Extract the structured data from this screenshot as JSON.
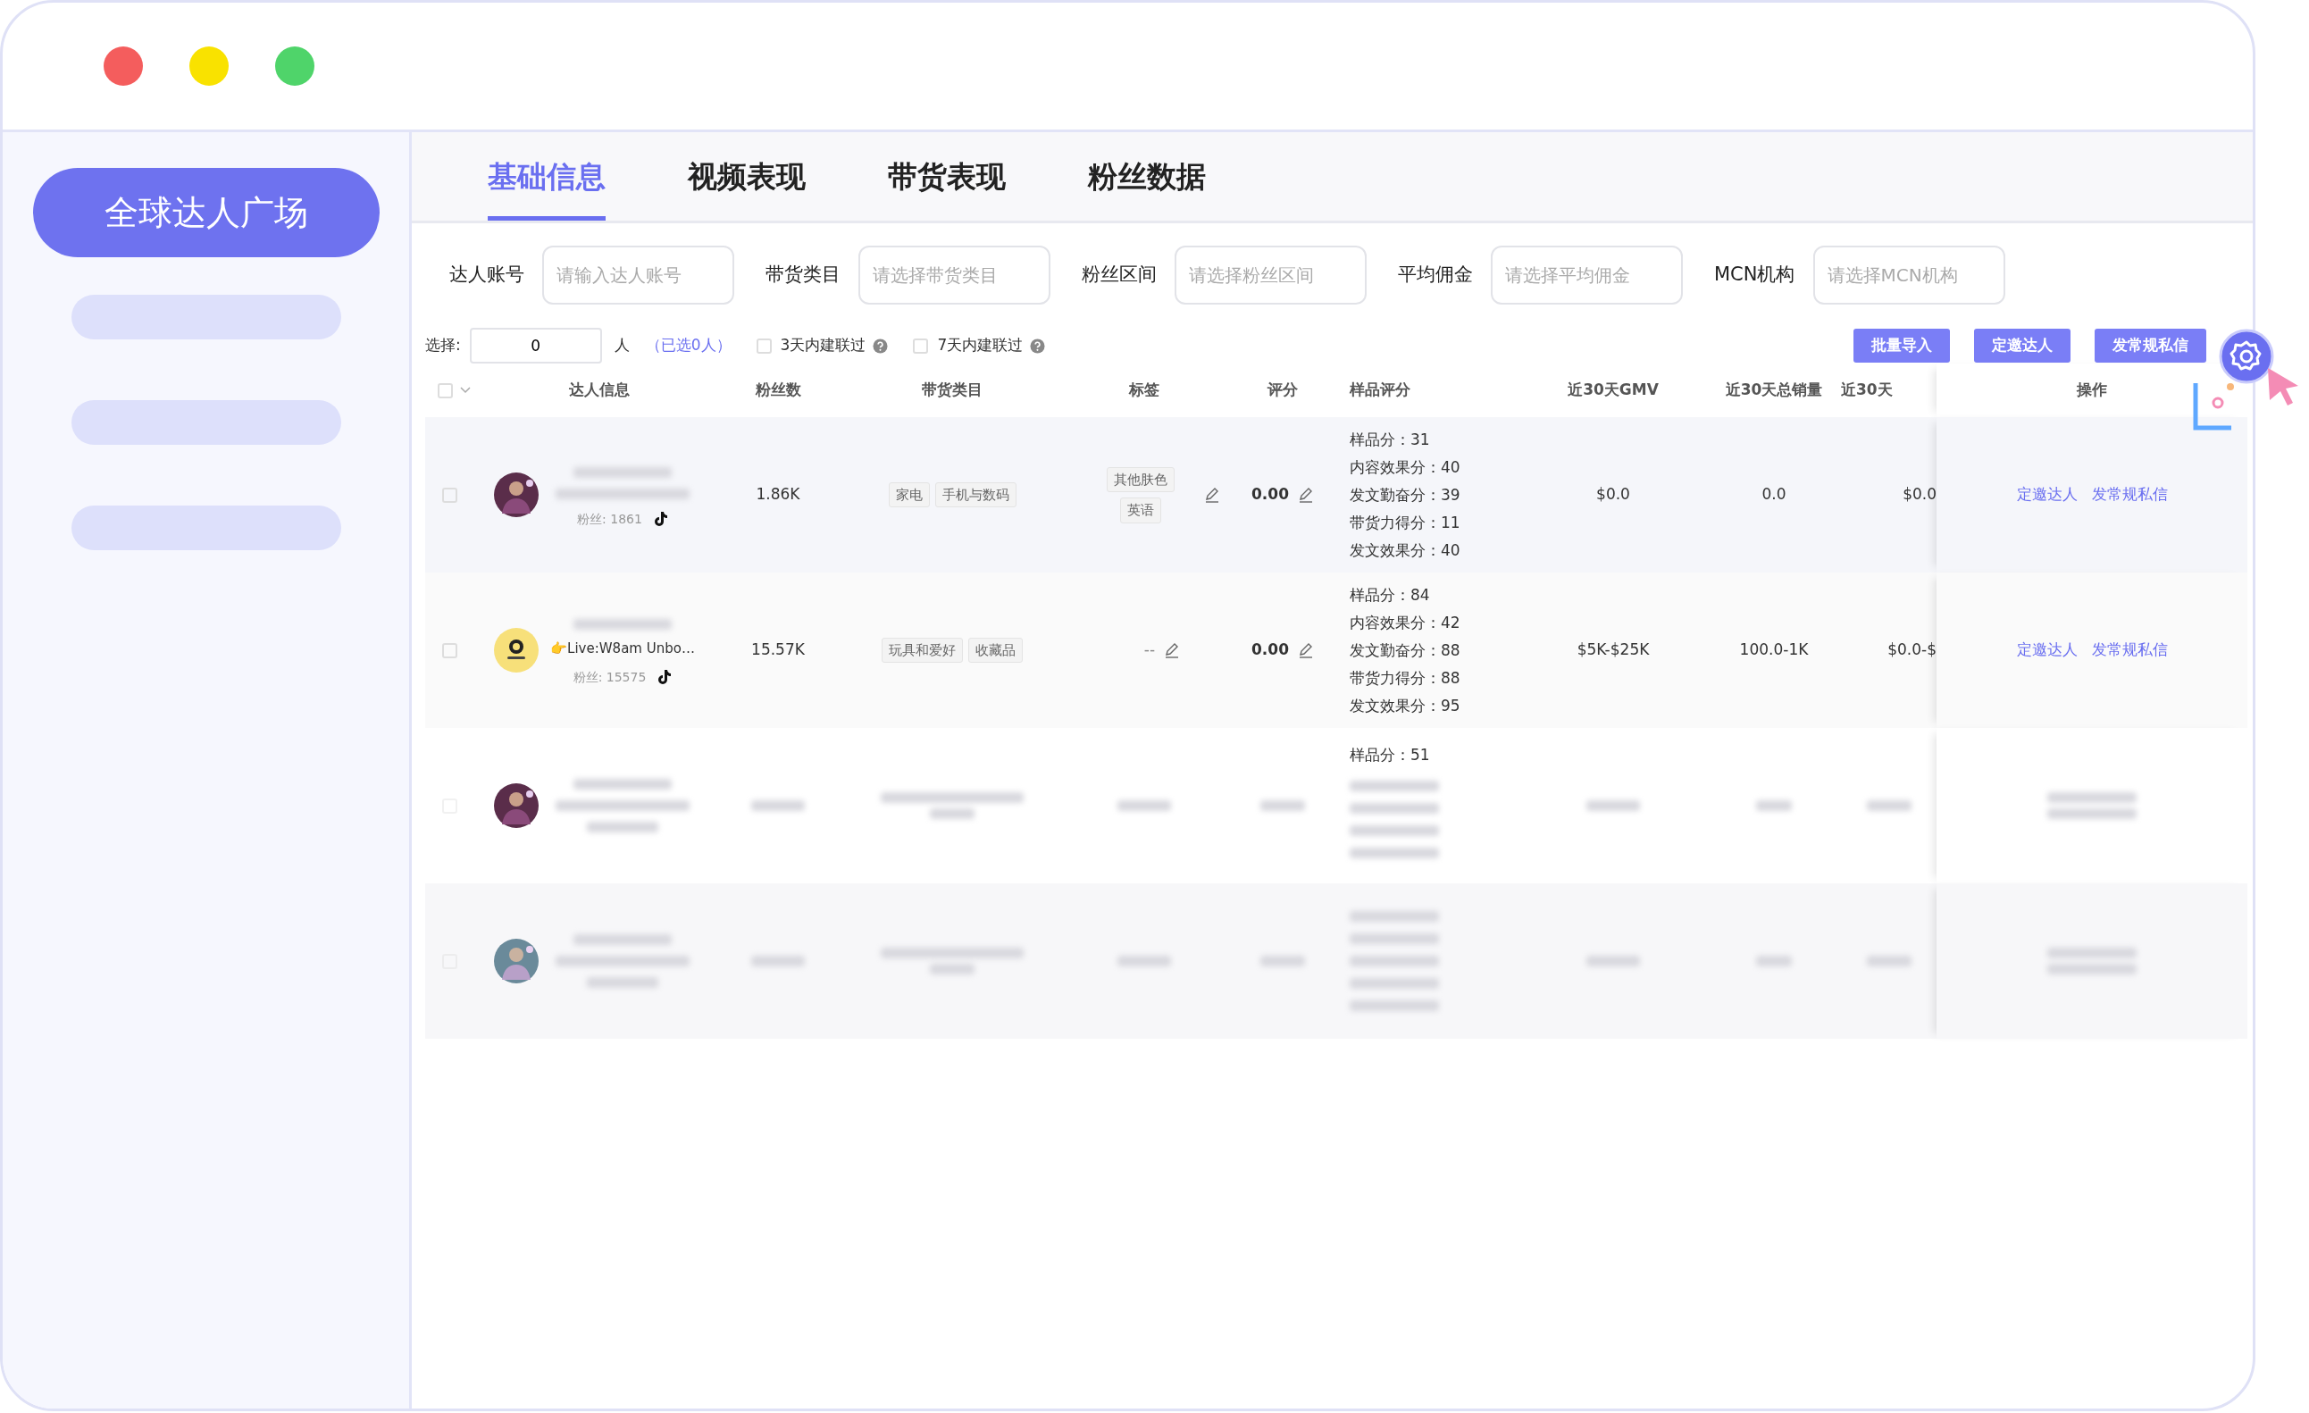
{
  "window": {
    "controls": [
      {
        "color": "#f45d5d"
      },
      {
        "color": "#f9e200"
      },
      {
        "color": "#4fd46a"
      }
    ]
  },
  "sidebar": {
    "title": "全球达人广场"
  },
  "tabs": [
    {
      "label": "基础信息",
      "selected": true
    },
    {
      "label": "视频表现",
      "selected": false
    },
    {
      "label": "带货表现",
      "selected": false
    },
    {
      "label": "粉丝数据",
      "selected": false
    }
  ],
  "filters": [
    {
      "label": "达人账号",
      "placeholder": "请输入达人账号"
    },
    {
      "label": "带货类目",
      "placeholder": "请选择带货类目"
    },
    {
      "label": "粉丝区间",
      "placeholder": "请选择粉丝区间"
    },
    {
      "label": "平均佣金",
      "placeholder": "请选择平均佣金"
    },
    {
      "label": "MCN机构",
      "placeholder": "请选择MCN机构"
    }
  ],
  "selection": {
    "label": "选择:",
    "value": "0",
    "unit": "人",
    "selected_count": "（已选0人）"
  },
  "checks": [
    {
      "label": "3天内建联过",
      "checked": false
    },
    {
      "label": "7天内建联过",
      "checked": false
    }
  ],
  "buttons": [
    "批量导入",
    "定邀达人",
    "发常规私信"
  ],
  "table": {
    "select_all": {
      "checked": false
    },
    "columns": [
      "达人信息",
      "粉丝数",
      "带货类目",
      "标签",
      "评分",
      "样品评分",
      "近30天GMV",
      "近30天总销量",
      "近30天",
      "操作"
    ],
    "rows": [
      {
        "blurred": false,
        "checked": false,
        "fans_label": "粉丝: 1861",
        "followers": "1.86K",
        "categories": [
          "家电",
          "手机与数码"
        ],
        "tags": [
          "其他肤色",
          "英语"
        ],
        "rating": "0.00",
        "sample_scores": [
          "样品分：31",
          "内容效果分：40",
          "发文勤奋分：39",
          "带货力得分：11",
          "发文效果分：40"
        ],
        "gmv": "$0.0",
        "sales": "0.0",
        "column_9": "$0.0",
        "actions": [
          "定邀达人",
          "发常规私信"
        ]
      },
      {
        "blurred": false,
        "checked": false,
        "bio": "👉Live:W8am Unbo…",
        "fans_label": "粉丝: 15575",
        "followers": "15.57K",
        "categories": [
          "玩具和爱好",
          "收藏品"
        ],
        "tags": [],
        "empty_tag": "--",
        "rating": "0.00",
        "sample_scores": [
          "样品分：84",
          "内容效果分：42",
          "发文勤奋分：88",
          "带货力得分：88",
          "发文效果分：95"
        ],
        "gmv": "$5K-$25K",
        "sales": "100.0-1K",
        "column_9": "$0.0-$",
        "actions": [
          "定邀达人",
          "发常规私信"
        ]
      },
      {
        "blurred": true,
        "checked": false,
        "sample_scores": [
          "样品分：51"
        ]
      },
      {
        "blurred": true,
        "checked": false,
        "sample_scores": []
      }
    ]
  }
}
